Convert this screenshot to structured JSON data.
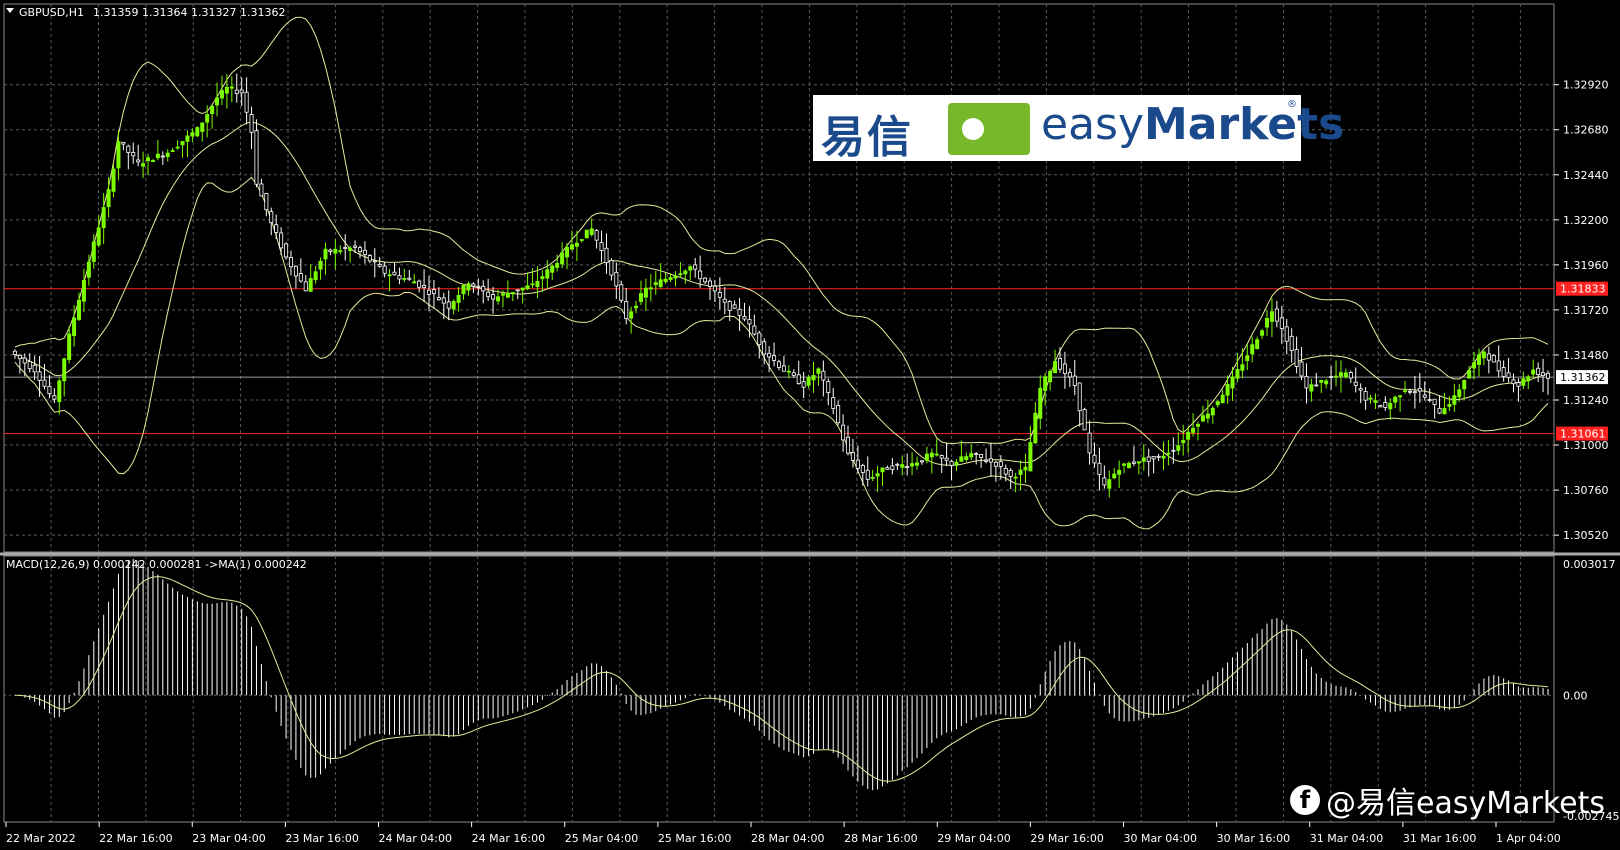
{
  "header": {
    "symbol": "GBPUSD,H1",
    "ohlc": "1.31359 1.31364 1.31327 1.31362"
  },
  "macd_header": "MACD(12,26,9) 0.000242 0.000281 ->MA(1) 0.000242",
  "watermark": {
    "cn": "易信",
    "en_pre": "easy",
    "en_bold": "Markets",
    "reg": "®"
  },
  "social": {
    "icon": "facebook-icon",
    "handle": "@易信easyMarkets"
  },
  "colors": {
    "background": "#000000",
    "grid": "#5a5a5a",
    "bull": "#7cfc00",
    "bear": "#ffffff",
    "bands": "#e8e89a",
    "hline": "#ff2020",
    "price_line": "#9a9a9a"
  },
  "chart_data": [
    {
      "type": "candlestick",
      "title": "GBPUSD,H1",
      "ylim": [
        1.3043,
        1.3335
      ],
      "y_ticks": [
        "1.32920",
        "1.32680",
        "1.32440",
        "1.32200",
        "1.31960",
        "1.31720",
        "1.31480",
        "1.31240",
        "1.31000",
        "1.30760",
        "1.30520"
      ],
      "x_ticks": [
        "22 Mar 2022",
        "22 Mar 16:00",
        "23 Mar 04:00",
        "23 Mar 16:00",
        "24 Mar 04:00",
        "24 Mar 16:00",
        "25 Mar 04:00",
        "25 Mar 16:00",
        "28 Mar 04:00",
        "28 Mar 16:00",
        "29 Mar 04:00",
        "29 Mar 16:00",
        "30 Mar 04:00",
        "30 Mar 16:00",
        "31 Mar 04:00",
        "31 Mar 16:00",
        "1 Apr 04:00"
      ],
      "horizontal_lines": [
        {
          "label": "1.31833",
          "value": 1.31833,
          "color": "#ff2020"
        },
        {
          "label": "1.31061",
          "value": 1.31061,
          "color": "#ff2020"
        }
      ],
      "current_price": {
        "label": "1.31362",
        "value": 1.31362
      },
      "price_keypoints": [
        [
          0,
          1.315
        ],
        [
          5,
          1.314
        ],
        [
          9,
          1.3123
        ],
        [
          12,
          1.3158
        ],
        [
          16,
          1.3198
        ],
        [
          20,
          1.3235
        ],
        [
          22,
          1.3262
        ],
        [
          26,
          1.325
        ],
        [
          32,
          1.3256
        ],
        [
          38,
          1.3268
        ],
        [
          42,
          1.3285
        ],
        [
          44,
          1.329
        ],
        [
          47,
          1.3288
        ],
        [
          49,
          1.3267
        ],
        [
          50,
          1.324
        ],
        [
          53,
          1.3218
        ],
        [
          56,
          1.32
        ],
        [
          60,
          1.3183
        ],
        [
          64,
          1.3203
        ],
        [
          70,
          1.3205
        ],
        [
          76,
          1.3192
        ],
        [
          82,
          1.3187
        ],
        [
          86,
          1.318
        ],
        [
          89,
          1.3174
        ],
        [
          93,
          1.3187
        ],
        [
          98,
          1.3178
        ],
        [
          102,
          1.3182
        ],
        [
          106,
          1.3185
        ],
        [
          110,
          1.3195
        ],
        [
          114,
          1.3207
        ],
        [
          118,
          1.3215
        ],
        [
          122,
          1.3192
        ],
        [
          125,
          1.3168
        ],
        [
          129,
          1.3183
        ],
        [
          134,
          1.319
        ],
        [
          138,
          1.3195
        ],
        [
          141,
          1.3187
        ],
        [
          145,
          1.3175
        ],
        [
          149,
          1.3168
        ],
        [
          153,
          1.315
        ],
        [
          157,
          1.314
        ],
        [
          161,
          1.3132
        ],
        [
          164,
          1.314
        ],
        [
          167,
          1.312
        ],
        [
          170,
          1.3095
        ],
        [
          174,
          1.3082
        ],
        [
          178,
          1.3088
        ],
        [
          183,
          1.309
        ],
        [
          187,
          1.3095
        ],
        [
          191,
          1.309
        ],
        [
          195,
          1.3095
        ],
        [
          200,
          1.309
        ],
        [
          203,
          1.3083
        ],
        [
          206,
          1.3087
        ],
        [
          209,
          1.313
        ],
        [
          212,
          1.3145
        ],
        [
          216,
          1.3132
        ],
        [
          219,
          1.3095
        ],
        [
          222,
          1.3078
        ],
        [
          225,
          1.3088
        ],
        [
          229,
          1.3092
        ],
        [
          233,
          1.3093
        ],
        [
          237,
          1.31
        ],
        [
          240,
          1.311
        ],
        [
          244,
          1.312
        ],
        [
          248,
          1.3135
        ],
        [
          251,
          1.3148
        ],
        [
          254,
          1.3162
        ],
        [
          256,
          1.3172
        ],
        [
          258,
          1.3163
        ],
        [
          260,
          1.315
        ],
        [
          263,
          1.313
        ],
        [
          267,
          1.3135
        ],
        [
          271,
          1.3138
        ],
        [
          275,
          1.3125
        ],
        [
          279,
          1.312
        ],
        [
          283,
          1.313
        ],
        [
          286,
          1.3128
        ],
        [
          290,
          1.3118
        ],
        [
          293,
          1.3125
        ],
        [
          296,
          1.314
        ],
        [
          299,
          1.315
        ],
        [
          302,
          1.314
        ],
        [
          306,
          1.3132
        ],
        [
          309,
          1.314
        ],
        [
          312,
          1.3136
        ]
      ],
      "series": [
        {
          "name": "price",
          "type": "candles"
        },
        {
          "name": "Bollinger upper",
          "type": "line"
        },
        {
          "name": "Bollinger middle",
          "type": "line"
        },
        {
          "name": "Bollinger lower",
          "type": "line"
        }
      ]
    },
    {
      "type": "histogram",
      "title": "MACD(12,26,9)",
      "ylim": [
        -0.002745,
        0.003017
      ],
      "y_ticks": [
        "0.003017",
        "0.00",
        "-0.002745"
      ],
      "values_note": "MACD main 0.000242, signal 0.000281"
    }
  ]
}
